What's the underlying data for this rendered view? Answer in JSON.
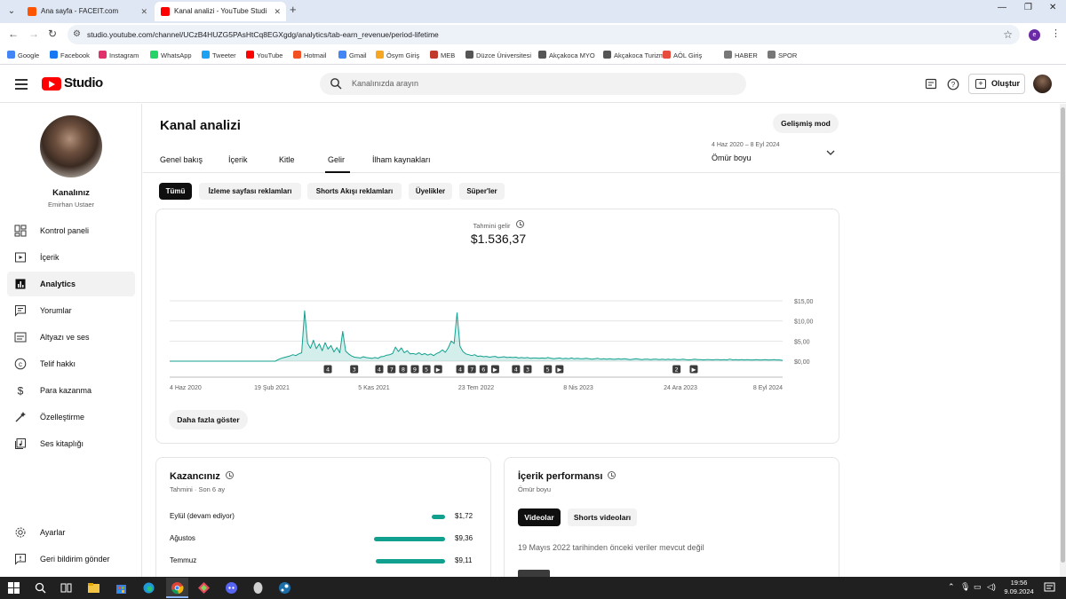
{
  "browser": {
    "tabs": [
      {
        "title": "Ana sayfa - FACEIT.com",
        "favicon_color": "#ff5500"
      },
      {
        "title": "Kanal analizi - YouTube Studio",
        "favicon_color": "#ff0000"
      }
    ],
    "url": "studio.youtube.com/channel/UCzB4HUZG5PAsHtCq8EGXgdg/analytics/tab-earn_revenue/period-lifetime",
    "profile_initial": "e",
    "bookmarks": [
      {
        "label": "Google",
        "color": "#4285f4"
      },
      {
        "label": "Facebook",
        "color": "#1877f2"
      },
      {
        "label": "Instagram",
        "color": "#e1306c"
      },
      {
        "label": "WhatsApp",
        "color": "#25d366"
      },
      {
        "label": "Tweeter",
        "color": "#1da1f2"
      },
      {
        "label": "YouTube",
        "color": "#ff0000"
      },
      {
        "label": "Hotmail",
        "color": "#f25022"
      },
      {
        "label": "Gmail",
        "color": "#4285f4"
      },
      {
        "label": "Ösym Giriş",
        "color": "#f5a623"
      },
      {
        "label": "MEB",
        "color": "#c0392b"
      },
      {
        "label": "Düzce Üniversitesi",
        "color": "#555555"
      },
      {
        "label": "Akçakoca MYO",
        "color": "#555555"
      },
      {
        "label": "Akçakoca Turizm",
        "color": "#555555"
      },
      {
        "label": "AÖL Giriş",
        "color": "#e74c3c"
      },
      {
        "label": "HABER",
        "color": "#777777"
      },
      {
        "label": "SPOR",
        "color": "#777777"
      }
    ]
  },
  "header": {
    "logo_text": "Studio",
    "search_placeholder": "Kanalınızda arayın",
    "create_label": "Oluştur"
  },
  "sidebar": {
    "channel_name": "Kanalınız",
    "channel_handle": "Emirhan Ustaer",
    "items": [
      {
        "label": "Kontrol paneli",
        "icon": "dashboard-icon",
        "active": false
      },
      {
        "label": "İçerik",
        "icon": "content-icon",
        "active": false
      },
      {
        "label": "Analytics",
        "icon": "analytics-icon",
        "active": true
      },
      {
        "label": "Yorumlar",
        "icon": "comments-icon",
        "active": false
      },
      {
        "label": "Altyazı ve ses",
        "icon": "subtitles-icon",
        "active": false
      },
      {
        "label": "Telif hakkı",
        "icon": "copyright-icon",
        "active": false
      },
      {
        "label": "Para kazanma",
        "icon": "monetization-icon",
        "active": false
      },
      {
        "label": "Özelleştirme",
        "icon": "customization-icon",
        "active": false
      },
      {
        "label": "Ses kitaplığı",
        "icon": "audio-library-icon",
        "active": false
      }
    ],
    "bottom_items": [
      {
        "label": "Ayarlar",
        "icon": "settings-icon"
      },
      {
        "label": "Geri bildirim gönder",
        "icon": "feedback-icon"
      }
    ]
  },
  "main": {
    "title": "Kanal analizi",
    "advanced_label": "Gelişmiş mod",
    "tabs": [
      "Genel bakış",
      "İçerik",
      "Kitle",
      "Gelir",
      "İlham kaynakları"
    ],
    "active_tab": "Gelir",
    "date_range": "4 Haz 2020 – 8 Eyl 2024",
    "date_period": "Ömür boyu",
    "chips": [
      "Tümü",
      "İzleme sayfası reklamları",
      "Shorts Akışı reklamları",
      "Üyelikler",
      "Süper'ler"
    ],
    "selected_chip": "Tümü",
    "metric_label": "Tahmini gelir",
    "metric_value": "$1.536,37",
    "show_more_label": "Daha fazla göster"
  },
  "chart_data": {
    "type": "area",
    "title": "",
    "xlabel": "",
    "ylabel": "",
    "x_ticks": [
      "4 Haz 2020",
      "19 Şub 2021",
      "5 Kas 2021",
      "23 Tem 2022",
      "8 Nis 2023",
      "24 Ara 2023",
      "8 Eyl 2024"
    ],
    "y_ticks": [
      "$15,00",
      "$10,00",
      "$5,00",
      "$0,00"
    ],
    "ylim": [
      0,
      15
    ],
    "y_axis_position": "right",
    "grid": true,
    "color": "#12a08e",
    "daily_revenue_usd_by_week": [
      0,
      0,
      0,
      0,
      0,
      0,
      0,
      0,
      0,
      0,
      0,
      0,
      0,
      0,
      0,
      0,
      0,
      0,
      0,
      0,
      0,
      0,
      0,
      0,
      0,
      0,
      0,
      0,
      0,
      0,
      0,
      0,
      0,
      0,
      0,
      0,
      0,
      0.4,
      0.7,
      0.9,
      1.1,
      1.3,
      1.6,
      1.4,
      1.8,
      2.1,
      12.5,
      4.5,
      3.2,
      5.2,
      3.1,
      4.3,
      2.6,
      4.6,
      3.0,
      3.9,
      2.3,
      3.4,
      2.1,
      7.4,
      2.5,
      1.8,
      1.3,
      1.0,
      0.9,
      0.8,
      1.1,
      0.9,
      0.8,
      0.7,
      0.9,
      0.7,
      1.1,
      1.2,
      1.5,
      1.6,
      1.9,
      3.5,
      2.4,
      3.3,
      2.1,
      2.6,
      1.8,
      1.9,
      1.7,
      2.1,
      1.6,
      1.9,
      1.5,
      1.8,
      1.4,
      1.9,
      2.2,
      2.8,
      2.2,
      3.3,
      5.0,
      4.4,
      12.0,
      3.7,
      2.4,
      1.8,
      1.6,
      1.4,
      1.6,
      1.2,
      1.3,
      1.1,
      1.2,
      1.0,
      1.1,
      1.2,
      0.9,
      1.0,
      1.1,
      0.9,
      1.0,
      0.9,
      1.0,
      0.8,
      0.9,
      0.8,
      0.9,
      0.7,
      0.8,
      0.8,
      0.7,
      0.8,
      0.7,
      0.9,
      0.7,
      0.6,
      0.7,
      0.8,
      0.6,
      0.7,
      0.6,
      0.8,
      0.6,
      0.7,
      0.6,
      0.6,
      0.7,
      0.6,
      0.5,
      0.6,
      0.7,
      0.5,
      0.6,
      0.5,
      0.6,
      0.5,
      0.5,
      0.6,
      0.5,
      0.6,
      0.5,
      0.4,
      0.5,
      0.6,
      0.5,
      0.4,
      0.5,
      0.5,
      0.4,
      0.5,
      0.5,
      0.4,
      0.5,
      0.4,
      0.5,
      0.4,
      0.5,
      0.4,
      0.4,
      0.5,
      0.4,
      0.3,
      0.4,
      0.5,
      0.4,
      0.4,
      0.3,
      0.4,
      0.4,
      0.3,
      0.4,
      0.4,
      0.3,
      0.4,
      0.3,
      0.5,
      0.3,
      0.4,
      0.3,
      0.4,
      0.3,
      0.4,
      0.3,
      0.3,
      0.4,
      0.3,
      0.3,
      0.4,
      0.3,
      0.3,
      0.4,
      0.3,
      0.3,
      0.2
    ],
    "markers": [
      {
        "label": "4",
        "x_frac": 0.258
      },
      {
        "label": "3",
        "x_frac": 0.301
      },
      {
        "label": "4",
        "x_frac": 0.342
      },
      {
        "label": "7",
        "x_frac": 0.362
      },
      {
        "label": "8",
        "x_frac": 0.381
      },
      {
        "label": "9",
        "x_frac": 0.4
      },
      {
        "label": "5",
        "x_frac": 0.419
      },
      {
        "label": "▶",
        "x_frac": 0.438
      },
      {
        "label": "4",
        "x_frac": 0.474
      },
      {
        "label": "7",
        "x_frac": 0.493
      },
      {
        "label": "6",
        "x_frac": 0.512
      },
      {
        "label": "▶",
        "x_frac": 0.531
      },
      {
        "label": "4",
        "x_frac": 0.565
      },
      {
        "label": "3",
        "x_frac": 0.584
      },
      {
        "label": "5",
        "x_frac": 0.617
      },
      {
        "label": "▶",
        "x_frac": 0.636
      },
      {
        "label": "2",
        "x_frac": 0.827
      },
      {
        "label": "▶",
        "x_frac": 0.855
      }
    ]
  },
  "earnings": {
    "title": "Kazancınız",
    "subtitle": "Tahmini · Son 6 ay",
    "rows": [
      {
        "month": "Eylül (devam ediyor)",
        "value": "$1,72",
        "amount": 1.72
      },
      {
        "month": "Ağustos",
        "value": "$9,36",
        "amount": 9.36
      },
      {
        "month": "Temmuz",
        "value": "$9,11",
        "amount": 9.11
      }
    ]
  },
  "performance": {
    "title": "İçerik performansı",
    "subtitle": "Ömür boyu",
    "chips": [
      "Videolar",
      "Shorts videoları"
    ],
    "selected_chip": "Videolar",
    "note": "19 Mayıs 2022 tarihinden önceki veriler mevcut değil"
  },
  "taskbar": {
    "time": "19:56",
    "date": "9.09.2024"
  }
}
